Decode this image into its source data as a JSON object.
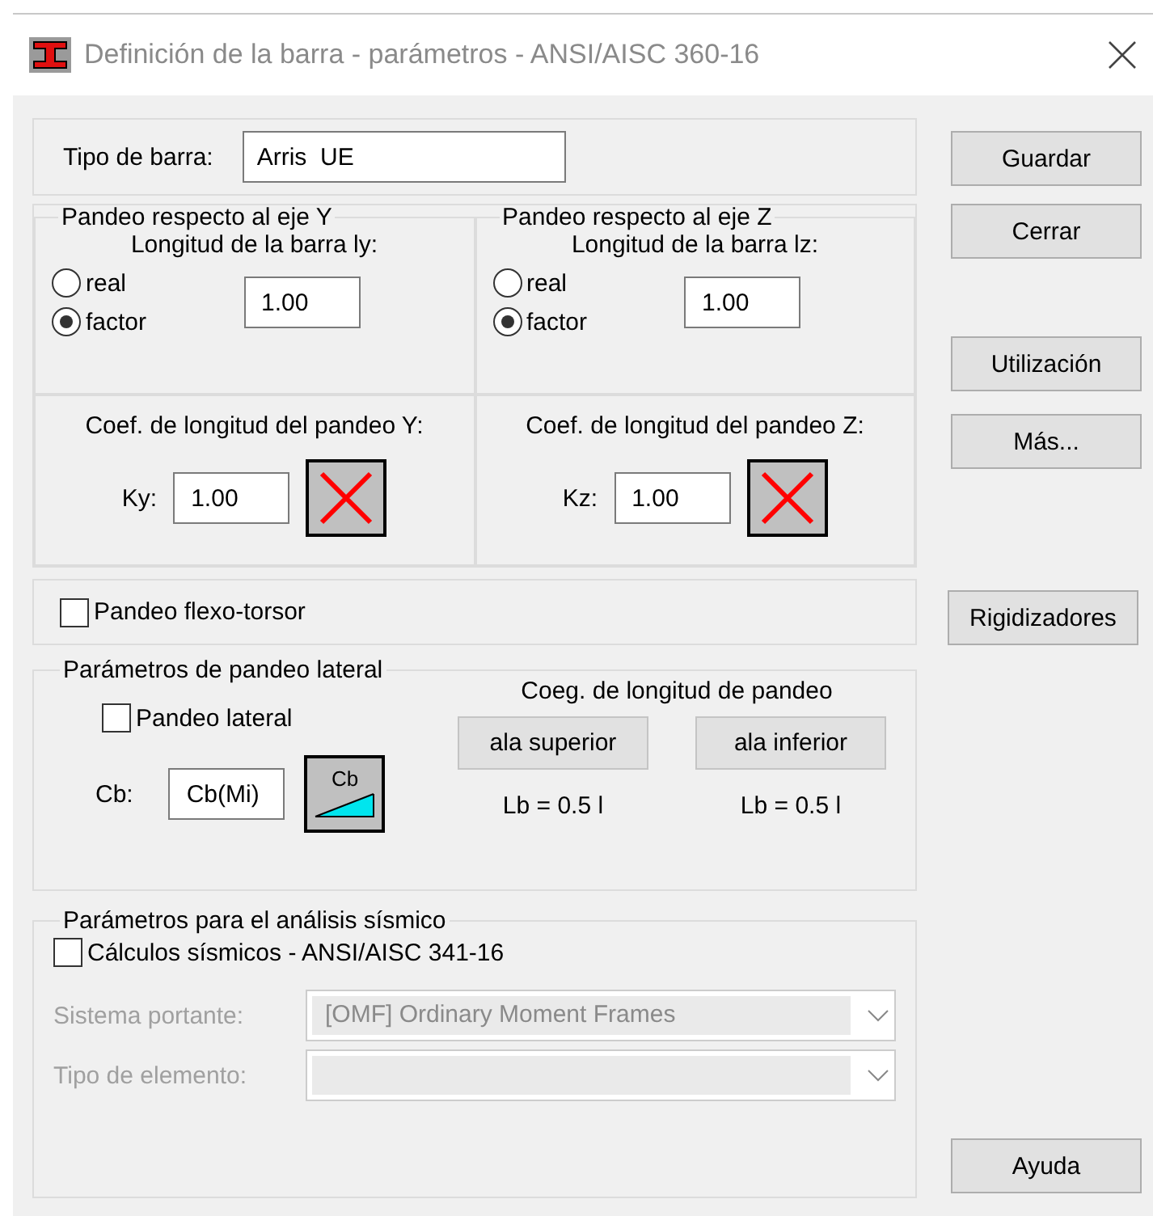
{
  "window": {
    "title": "Definición de la barra - parámetros - ANSI/AISC 360-16"
  },
  "member_type": {
    "label": "Tipo de barra:",
    "value": "Arris  UE"
  },
  "buckling": [
    {
      "title": "Pandeo respecto al eje Y",
      "length_label": "Longitud de la barra ly:",
      "options": [
        {
          "label": "real",
          "selected": false
        },
        {
          "label": "factor",
          "selected": true
        }
      ],
      "factor": "1.00",
      "coef_label": "Coef. de longitud del pandeo Y:",
      "k_label": "Ky:",
      "k_value": "1.00"
    },
    {
      "title": "Pandeo respecto al eje Z",
      "length_label": "Longitud de la barra lz:",
      "options": [
        {
          "label": "real",
          "selected": false
        },
        {
          "label": "factor",
          "selected": true
        }
      ],
      "factor": "1.00",
      "coef_label": "Coef. de longitud del pandeo Z:",
      "k_label": "Kz:",
      "k_value": "1.00"
    }
  ],
  "flexural_torsional": {
    "label": "Pandeo flexo-torsor",
    "checked": false
  },
  "lateral": {
    "title": "Parámetros de pandeo lateral",
    "checkbox": {
      "label": "Pandeo lateral",
      "checked": false
    },
    "cb_label": "Cb:",
    "cb_value": "Cb(Mi)",
    "cb_button": "Cb",
    "coef_label": "Coeg. de longitud de pandeo",
    "flanges": [
      {
        "button": "ala superior",
        "reading": "Lb = 0.5 l"
      },
      {
        "button": "ala inferior",
        "reading": "Lb = 0.5 l"
      }
    ]
  },
  "seismic": {
    "title": "Parámetros para el análisis sísmico",
    "checkbox": {
      "label": "Cálculos sísmicos - ANSI/AISC 341-16",
      "checked": false
    },
    "fields": [
      {
        "label": "Sistema portante:",
        "value": "[OMF] Ordinary Moment Frames",
        "disabled": true
      },
      {
        "label": "Tipo de elemento:",
        "disabled": true
      }
    ]
  },
  "buttons": [
    {
      "label": "Guardar"
    },
    {
      "label": "Cerrar"
    },
    {
      "label": "Utilización"
    },
    {
      "label": "Más..."
    },
    {
      "label": "Rigidizadores"
    },
    {
      "label": "Ayuda"
    }
  ]
}
